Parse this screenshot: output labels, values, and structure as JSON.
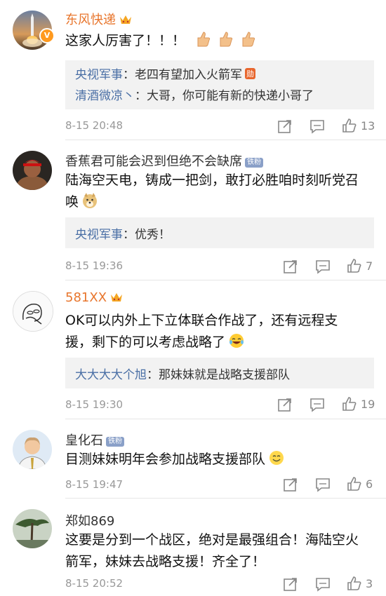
{
  "comments": [
    {
      "username": "东风快递",
      "text": "这家人厉害了！！！",
      "replies": [
        {
          "user": "央视军事",
          "text": "：老四有望加入火箭军",
          "tag": "勋"
        },
        {
          "user": "清酒微凉丶",
          "text": "：大哥，你可能有新的快递小哥了"
        }
      ],
      "time": "8-15 20:48",
      "likes": "13"
    },
    {
      "username": "香蕉君可能会迟到但绝不会缺席",
      "badge": "铁粉",
      "text_line1": "陆海空天电，铸成一把剑，敢打必胜咱时刻听党召",
      "text_line2": "唤",
      "replies": [
        {
          "user": "央视军事",
          "text": "：优秀！"
        }
      ],
      "time": "8-15 19:36",
      "likes": "7"
    },
    {
      "username": "581XX",
      "text_line1": "OK可以内外上下立体联合作战了，还有远程支",
      "text_line2": "援，剩下的可以考虑战略了",
      "replies": [
        {
          "user": "大大大大个旭",
          "text": "：那妹妹就是战略支援部队"
        }
      ],
      "time": "8-15 19:30",
      "likes": "19"
    },
    {
      "username": "皇化石",
      "badge": "铁粉",
      "text": "目测妹妹明年会参加战略支援部队",
      "time": "8-15 19:47",
      "likes": "6"
    },
    {
      "username": "郑如869",
      "text_line1": "这要是分到一个战区，绝对是最强组合！海陆空火",
      "text_line2": "箭军，妹妹去战略支援！齐全了！",
      "time": "8-15 20:52",
      "likes": "3"
    }
  ],
  "icons": {
    "verified": "V",
    "share": "share-icon",
    "comment": "comment-icon",
    "like": "thumbs-up-icon"
  },
  "colors": {
    "vip_name": "#e8762d",
    "reply_user": "#4a6fa5",
    "reply_bg": "#f2f2f2",
    "meta": "#999999"
  }
}
